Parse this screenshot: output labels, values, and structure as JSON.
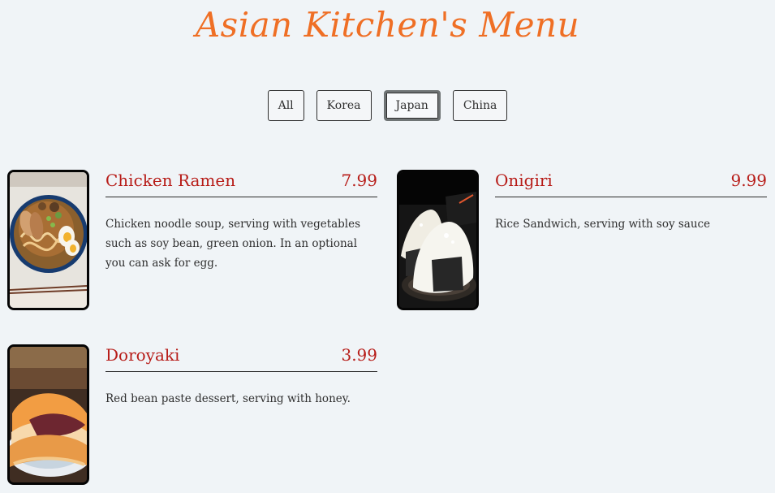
{
  "header": {
    "title": "Asian Kitchen's Menu"
  },
  "filters": {
    "items": [
      {
        "label": "All",
        "active": false
      },
      {
        "label": "Korea",
        "active": false
      },
      {
        "label": "Japan",
        "active": true
      },
      {
        "label": "China",
        "active": false
      }
    ]
  },
  "menu": {
    "items": [
      {
        "name": "Chicken Ramen",
        "price": "7.99",
        "description": "Chicken noodle soup, serving with vegetables such as soy bean, green onion. In an optional you can ask for egg.",
        "image_icon": "ramen-bowl-photo"
      },
      {
        "name": "Onigiri",
        "price": "9.99",
        "description": "Rice Sandwich, serving with soy sauce",
        "image_icon": "onigiri-photo"
      },
      {
        "name": "Doroyaki",
        "price": "3.99",
        "description": "Red bean paste dessert, serving with honey.",
        "image_icon": "dorayaki-photo"
      }
    ]
  },
  "colors": {
    "background": "#f0f4f7",
    "title": "#ef6f25",
    "item_name": "#b71c18",
    "text": "#2f2f2f"
  }
}
